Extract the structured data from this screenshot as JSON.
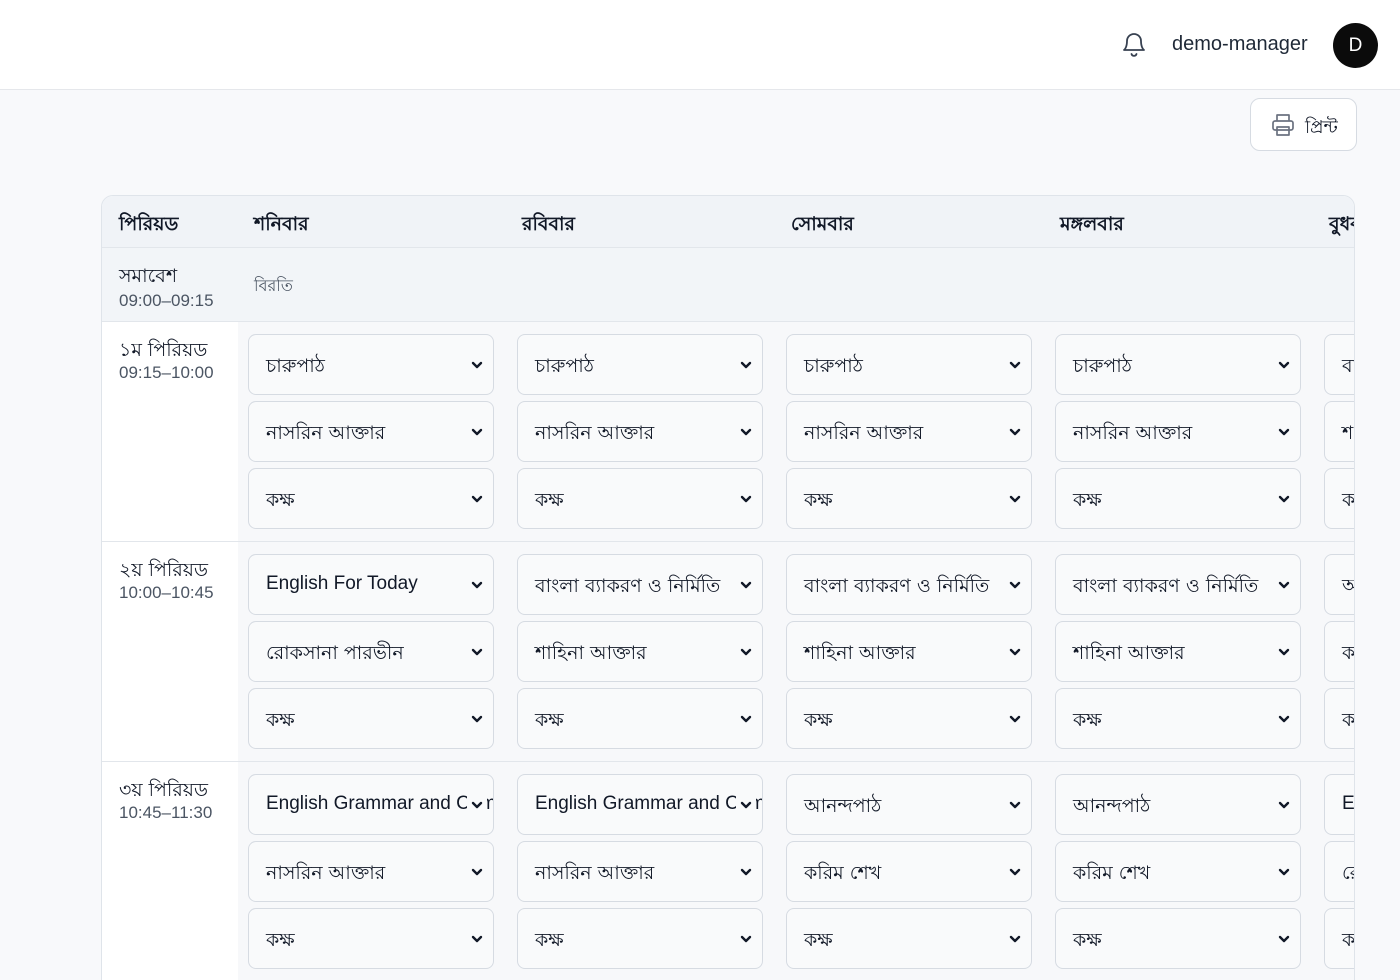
{
  "header": {
    "username": "demo-manager",
    "avatar_initial": "D",
    "notification_icon": "bell-icon"
  },
  "toolbar": {
    "print_label": "প্রিন্ট",
    "print_icon": "printer-icon"
  },
  "routine": {
    "period_column_header": "পিরিয়ড",
    "days": [
      "শনিবার",
      "রবিবার",
      "সোমবার",
      "মঙ্গলবার",
      "বুধবার"
    ],
    "assembly": {
      "label": "সমাবেশ",
      "time": "09:00–09:15",
      "note": "বিরতি"
    },
    "periods": [
      {
        "label": "১ম পিরিয়ড",
        "time": "09:15–10:00",
        "cells": [
          {
            "subject": "চারুপাঠ",
            "teacher": "নাসরিন আক্তার",
            "room": "কক্ষ"
          },
          {
            "subject": "চারুপাঠ",
            "teacher": "নাসরিন আক্তার",
            "room": "কক্ষ"
          },
          {
            "subject": "চারুপাঠ",
            "teacher": "নাসরিন আক্তার",
            "room": "কক্ষ"
          },
          {
            "subject": "চারুপাঠ",
            "teacher": "নাসরিন আক্তার",
            "room": "কক্ষ"
          },
          {
            "subject": "বা",
            "teacher": "শ",
            "room": "ক"
          }
        ]
      },
      {
        "label": "২য় পিরিয়ড",
        "time": "10:00–10:45",
        "cells": [
          {
            "subject": "English For Today",
            "teacher": "রোকসানা পারভীন",
            "room": "কক্ষ"
          },
          {
            "subject": "বাংলা ব্যাকরণ ও নির্মিতি",
            "teacher": "শাহিনা আক্তার",
            "room": "কক্ষ"
          },
          {
            "subject": "বাংলা ব্যাকরণ ও নির্মিতি",
            "teacher": "শাহিনা আক্তার",
            "room": "কক্ষ"
          },
          {
            "subject": "বাংলা ব্যাকরণ ও নির্মিতি",
            "teacher": "শাহিনা আক্তার",
            "room": "কক্ষ"
          },
          {
            "subject": "আ",
            "teacher": "ক",
            "room": "ক"
          }
        ]
      },
      {
        "label": "৩য় পিরিয়ড",
        "time": "10:45–11:30",
        "cells": [
          {
            "subject": "English Grammar and Composition",
            "teacher": "নাসরিন আক্তার",
            "room": "কক্ষ"
          },
          {
            "subject": "English Grammar and Composition",
            "teacher": "নাসরিন আক্তার",
            "room": "কক্ষ"
          },
          {
            "subject": "আনন্দপাঠ",
            "teacher": "করিম শেখ",
            "room": "কক্ষ"
          },
          {
            "subject": "আনন্দপাঠ",
            "teacher": "করিম শেখ",
            "room": "কক্ষ"
          },
          {
            "subject": "E",
            "teacher": "রো",
            "room": "ক"
          }
        ]
      }
    ]
  }
}
